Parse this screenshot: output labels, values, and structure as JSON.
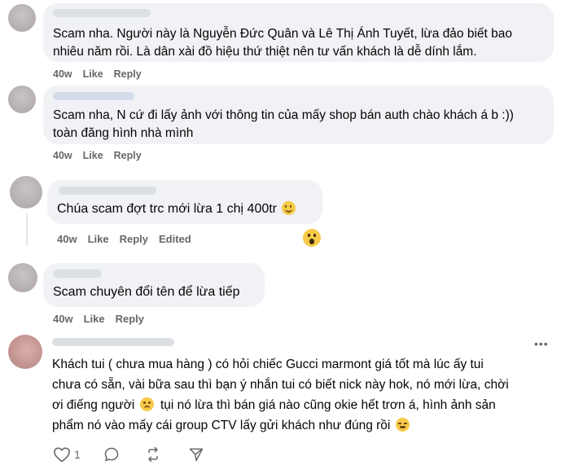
{
  "comments": [
    {
      "text_lines": [
        "Scam nha. Người này là Nguyễn Đức Quân và Lê Thị Ánh Tuyết, lừa đảo biết bao",
        "nhiêu năm rồi. Là dân xài đồ hiệu thứ thiệt nên tư vấn khách là dễ dính lắm."
      ],
      "time": "40w",
      "like": "Like",
      "reply": "Reply"
    },
    {
      "text_lines": [
        "Scam nha, N cứ đi lấy ảnh với thông tin của mấy shop bán auth chào khách á b :))",
        "toàn đăng hình nhà mình"
      ],
      "time": "40w",
      "like": "Like",
      "reply": "Reply"
    },
    {
      "text_lines": [
        "Chúa scam đợt trc mới lừa 1 chị 400tr"
      ],
      "time": "40w",
      "like": "Like",
      "reply": "Reply",
      "edited": "Edited",
      "reaction_icon": "wow-emoji-icon"
    },
    {
      "text_lines": [
        "Scam chuyên đổi tên để lừa tiếp"
      ],
      "time": "40w",
      "like": "Like",
      "reply": "Reply"
    },
    {
      "text_lines": [
        "Khách tui ( chưa mua hàng ) có hỏi chiếc Gucci marmont giá tốt mà lúc ấy tui",
        "chưa có sẵn, vài bữa sau thì bạn ý nhắn tui có biết nick này hok, nó mới lừa, chời",
        "ơi điếng người",
        "tụi nó lừa thì bán giá nào cũng okie hết trơn á, hình ảnh sản",
        "phẩm nó vào mấy cái group CTV lấy gửi khách như đúng rồi"
      ],
      "more_icon": "more-dots-icon"
    }
  ],
  "post_actions": {
    "like_count": "1",
    "icons": [
      "heart-icon",
      "comment-icon",
      "repost-icon",
      "share-icon"
    ]
  },
  "colors": {
    "bubble": "#f0f2f5",
    "meta_text": "#65676b",
    "text": "#050505"
  }
}
